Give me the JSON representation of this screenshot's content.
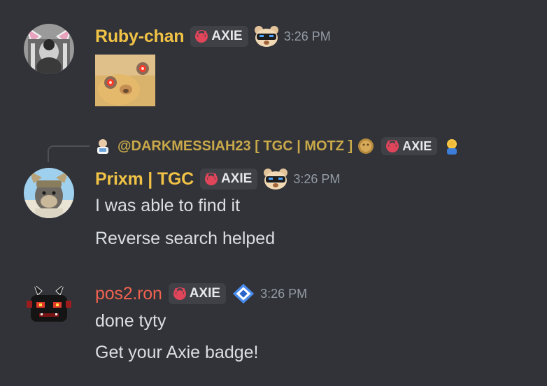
{
  "messages": [
    {
      "username": "Ruby-chan",
      "username_color": "#f0c246",
      "tag_label": "AXIE",
      "badge_icon": "bear-sunglasses-icon",
      "time": "3:26 PM",
      "attachment_icon": "glowing-eyes-emoji-image"
    },
    {
      "reply": {
        "mention": "@DARKMESSIAH23 [ TGC | MOTZ ]",
        "mention_color": "#c9a94a",
        "tag_label": "AXIE"
      },
      "username": "Prixm | TGC",
      "username_color": "#f0c246",
      "tag_label": "AXIE",
      "badge_icon": "bear-sunglasses-icon",
      "time": "3:26 PM",
      "lines": [
        "I was able to find it",
        "Reverse search helped"
      ]
    },
    {
      "username": "pos2.ron",
      "username_color": "#f0624f",
      "tag_label": "AXIE",
      "badge_icon": "diamond-gem-icon",
      "time": "3:26 PM",
      "lines": [
        "done tyty",
        "Get your Axie badge!"
      ]
    }
  ],
  "colors": {
    "background": "#313338",
    "text": "#dbdee1",
    "timestamp": "#949ba4",
    "tag_background": "#3f4147",
    "axie_logo": "#e0455a"
  }
}
